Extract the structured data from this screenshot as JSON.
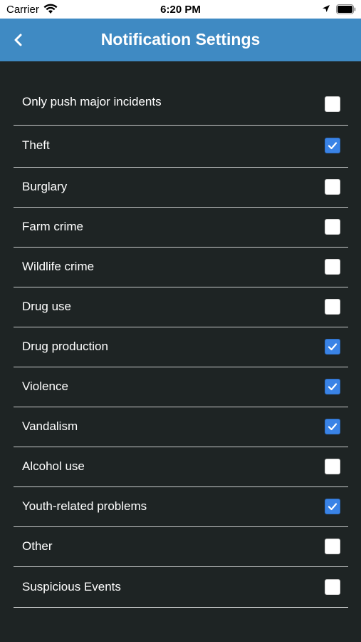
{
  "status": {
    "carrier": "Carrier",
    "time": "6:20 PM"
  },
  "nav": {
    "back_icon": "chevron-left-icon",
    "title": "Notification Settings"
  },
  "colors": {
    "nav_bg": "#3f8ac3",
    "page_bg": "#1e2424",
    "checkbox_checked": "#3a83e6"
  },
  "settings": [
    {
      "label": "Only push major incidents",
      "checked": false
    },
    {
      "label": "Theft",
      "checked": true
    },
    {
      "label": "Burglary",
      "checked": false
    },
    {
      "label": "Farm crime",
      "checked": false
    },
    {
      "label": "Wildlife crime",
      "checked": false
    },
    {
      "label": "Drug use",
      "checked": false
    },
    {
      "label": "Drug production",
      "checked": true
    },
    {
      "label": "Violence",
      "checked": true
    },
    {
      "label": "Vandalism",
      "checked": true
    },
    {
      "label": "Alcohol use",
      "checked": false
    },
    {
      "label": "Youth-related problems",
      "checked": true
    },
    {
      "label": "Other",
      "checked": false
    },
    {
      "label": "Suspicious Events",
      "checked": false
    }
  ]
}
